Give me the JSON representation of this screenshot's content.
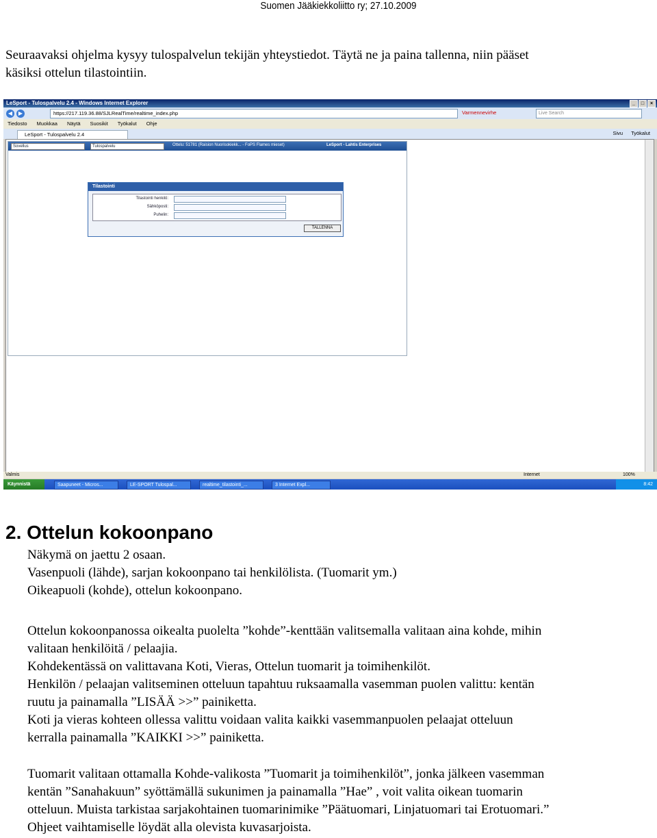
{
  "header": "Suomen Jääkiekkoliitto ry; 27.10.2009",
  "intro": [
    "Seuraavaksi ohjelma kysyy tulospalvelun tekijän yhteystiedot. Täytä ne ja paina tallenna, niin pääset",
    "käsiksi ottelun tilastointiin."
  ],
  "screenshot": {
    "window_title": "LeSport - Tulospalvelu 2.4 - Windows Internet Explorer",
    "url": "https://217.119.36.88/SJLRealTime/realtime_index.php",
    "cert": "Varmennevirhe",
    "search_placeholder": "Live Search",
    "menu": [
      "Tiedosto",
      "Muokkaa",
      "Näytä",
      "Suosikit",
      "Työkalut",
      "Ohje"
    ],
    "tab": "LeSport - Tulospalvelu 2.4",
    "tools": [
      "Sivu",
      "Työkalut"
    ],
    "selects": [
      "Sovellus",
      "Tulospalvelu"
    ],
    "match_info": "Ottelu: 51781 (Raision Nuorisokiekk... - FoPS Flames mieset)",
    "brand": "LeSport - Lahtis Enterprises",
    "dialog_title": "Tilastointi",
    "fields": [
      "Tilastointi henkilö:",
      "Sähköposti:",
      "Puhelin:"
    ],
    "save_label": "TALLENNA",
    "status_left": "Valmis",
    "status_zone": "Internet",
    "zoom": "100%",
    "start": "Käynnistä",
    "tasks": [
      "Saapuneet - Micros...",
      "LE-SPORT Tulospal...",
      "realtime_tilastointi_...",
      "3 Internet Expl..."
    ],
    "clock": "8:42"
  },
  "section2": {
    "heading": "2. Ottelun kokoonpano",
    "lines1": [
      "Näkymä on jaettu 2 osaan.",
      "Vasenpuoli (lähde), sarjan kokoonpano tai henkilölista. (Tuomarit ym.)",
      "Oikeapuoli (kohde), ottelun kokoonpano."
    ],
    "p1": [
      "Ottelun kokoonpanossa oikealta puolelta ”kohde”-kenttään valitsemalla valitaan aina kohde, mihin",
      "valitaan henkilöitä / pelaajia.",
      "Kohdekentässä on valittavana Koti, Vieras, Ottelun tuomarit ja toimihenkilöt.",
      "Henkilön / pelaajan valitseminen otteluun tapahtuu ruksaamalla vasemman puolen valittu: kentän",
      "ruutu ja painamalla ”LISÄÄ >>” painiketta.",
      "Koti ja vieras kohteen ollessa valittu voidaan valita kaikki vasemmanpuolen pelaajat otteluun",
      "kerralla painamalla ”KAIKKI >>” painiketta."
    ],
    "p2": [
      "Tuomarit valitaan ottamalla Kohde-valikosta ”Tuomarit ja toimihenkilöt”, jonka jälkeen vasemman",
      "kentän ”Sanahakuun” syöttämällä sukunimen ja painamalla ”Hae” , voit valita oikean tuomarin",
      "otteluun. Muista tarkistaa sarjakohtainen tuomarinimike ”Päätuomari, Linjatuomari tai Erotuomari.”",
      "Ohjeet vaihtamiselle löydät alla olevista kuvasarjoista."
    ]
  }
}
